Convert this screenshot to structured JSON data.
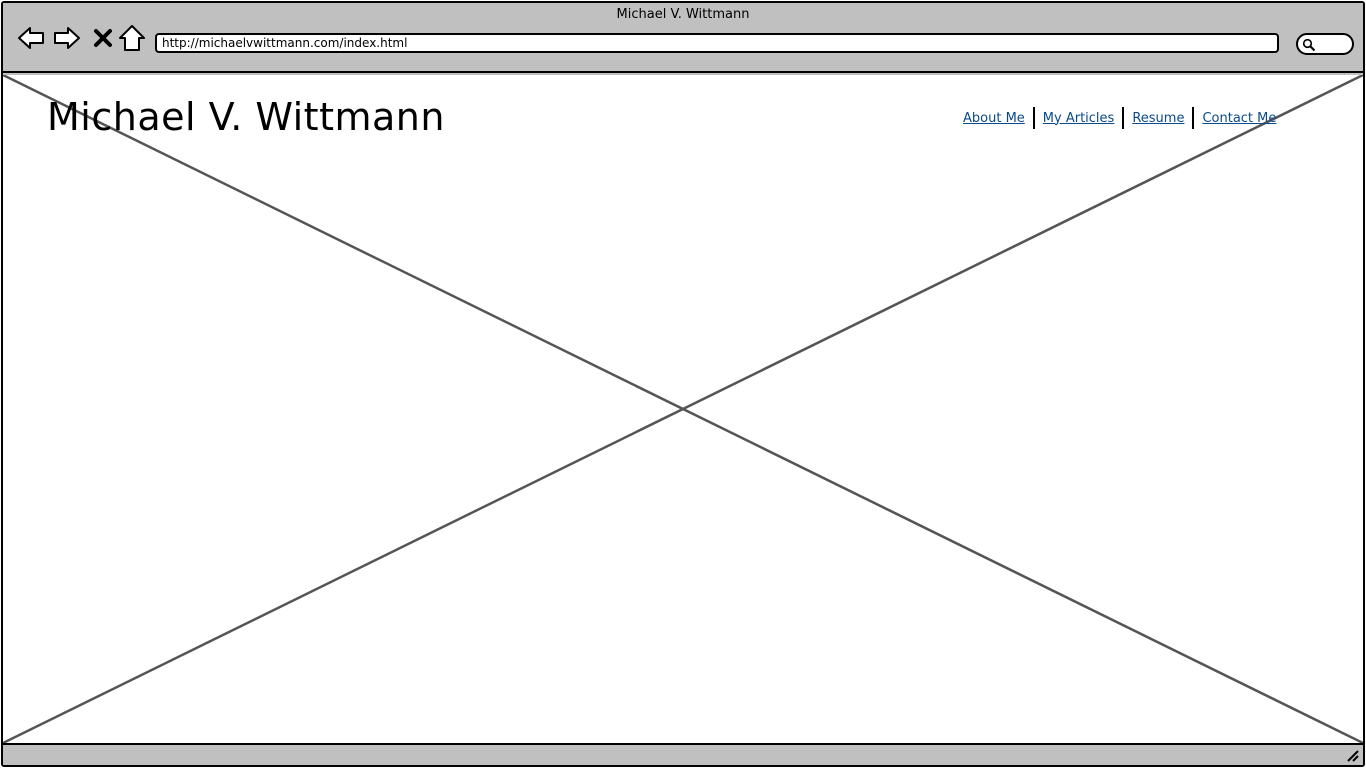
{
  "window": {
    "title": "Michael V. Wittmann"
  },
  "toolbar": {
    "back_icon": "back-arrow-icon",
    "forward_icon": "forward-arrow-icon",
    "stop_icon": "close-icon",
    "home_icon": "home-icon",
    "url": "http://michaelvwittmann.com/index.html",
    "search_icon": "search-icon"
  },
  "page": {
    "site_title": "Michael V. Wittmann",
    "nav": [
      {
        "label": "About Me"
      },
      {
        "label": "My Articles"
      },
      {
        "label": "Resume"
      },
      {
        "label": "Contact Me"
      }
    ],
    "image_placeholder": "image-placeholder"
  },
  "colors": {
    "chrome": "#c0c0c0",
    "link": "#0b4a8b",
    "placeholder_line": "#555555"
  }
}
